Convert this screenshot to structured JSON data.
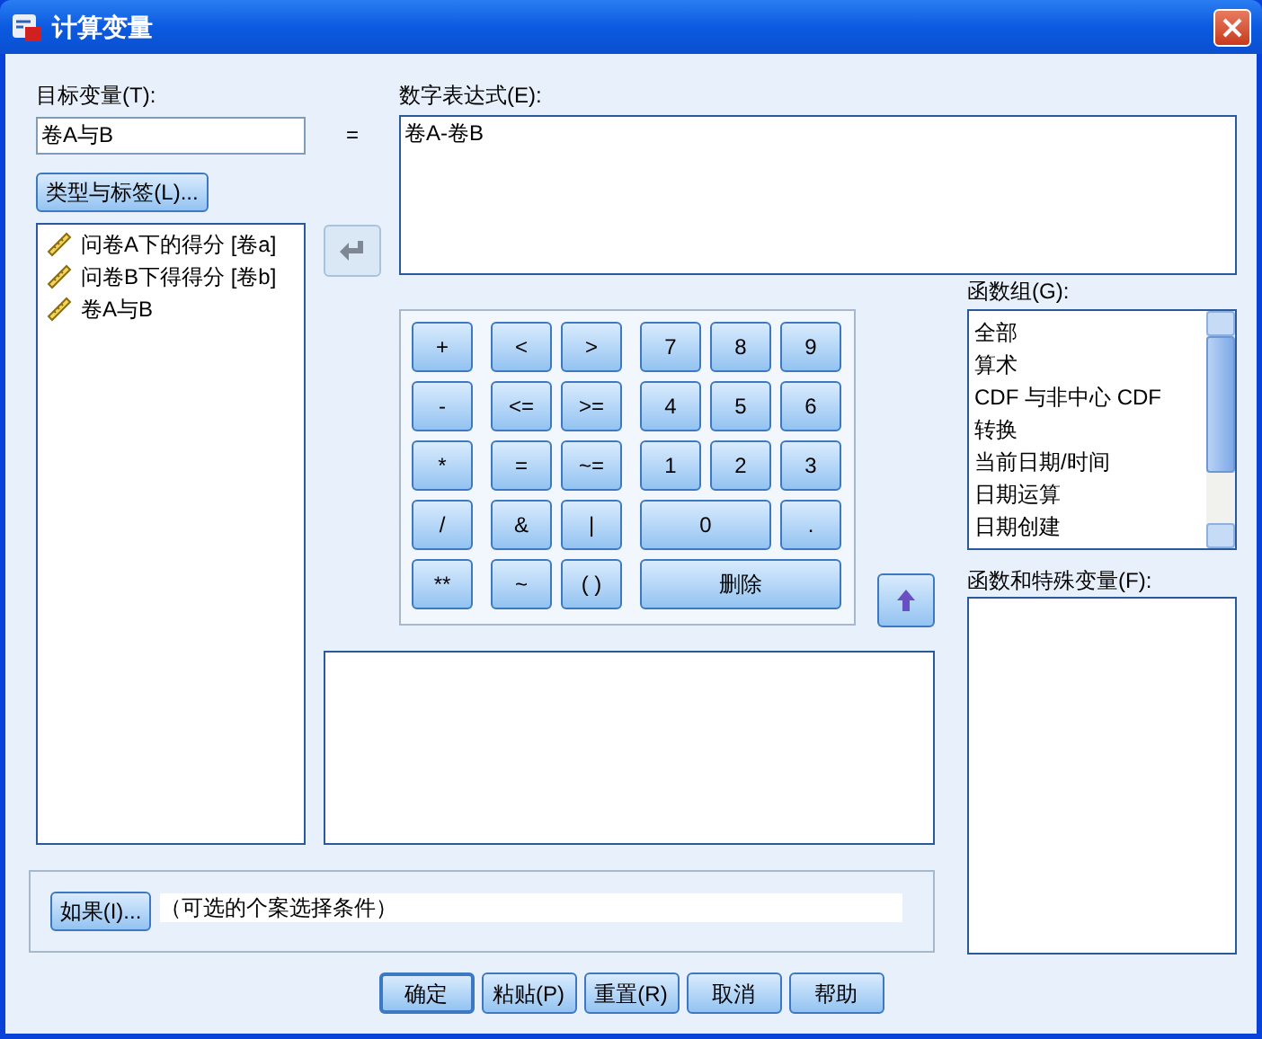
{
  "window": {
    "title": "计算变量"
  },
  "target_variable": {
    "label": "目标变量(T):",
    "value": "卷A与B"
  },
  "equals": "=",
  "type_label_button": "类型与标签(L)...",
  "variables": [
    {
      "name": "问卷A下的得分 [卷a]"
    },
    {
      "name": "问卷B下得得分 [卷b]"
    },
    {
      "name": "卷A与B"
    }
  ],
  "expression": {
    "label": "数字表达式(E):",
    "value": "卷A-卷B"
  },
  "keypad": [
    [
      {
        "label": "+",
        "kind": "key"
      },
      {
        "label": "<",
        "kind": "key"
      },
      {
        "label": ">",
        "kind": "key"
      },
      {
        "label": "7",
        "kind": "key"
      },
      {
        "label": "8",
        "kind": "key"
      },
      {
        "label": "9",
        "kind": "key"
      }
    ],
    [
      {
        "label": "-",
        "kind": "key"
      },
      {
        "label": "<=",
        "kind": "key"
      },
      {
        "label": ">=",
        "kind": "key"
      },
      {
        "label": "4",
        "kind": "key"
      },
      {
        "label": "5",
        "kind": "key"
      },
      {
        "label": "6",
        "kind": "key"
      }
    ],
    [
      {
        "label": "*",
        "kind": "key"
      },
      {
        "label": "=",
        "kind": "key"
      },
      {
        "label": "~=",
        "kind": "key"
      },
      {
        "label": "1",
        "kind": "key"
      },
      {
        "label": "2",
        "kind": "key"
      },
      {
        "label": "3",
        "kind": "key"
      }
    ],
    [
      {
        "label": "/",
        "kind": "key"
      },
      {
        "label": "&",
        "kind": "key"
      },
      {
        "label": "|",
        "kind": "key"
      },
      {
        "label": "0",
        "kind": "double"
      },
      {
        "label": ".",
        "kind": "key"
      }
    ],
    [
      {
        "label": "**",
        "kind": "key"
      },
      {
        "label": "~",
        "kind": "key"
      },
      {
        "label": "( )",
        "kind": "key"
      },
      {
        "label": "删除",
        "kind": "triple"
      }
    ]
  ],
  "function_groups": {
    "label": "函数组(G):",
    "items": [
      "全部",
      "算术",
      "CDF 与非中心 CDF",
      "转换",
      "当前日期/时间",
      "日期运算",
      "日期创建"
    ]
  },
  "functions": {
    "label": "函数和特殊变量(F):"
  },
  "condition": {
    "button": "如果(I)...",
    "text": "（可选的个案选择条件）"
  },
  "buttons": [
    {
      "label": "确定",
      "default": true
    },
    {
      "label": "粘贴(P)",
      "default": false
    },
    {
      "label": "重置(R)",
      "default": false
    },
    {
      "label": "取消",
      "default": false
    },
    {
      "label": "帮助",
      "default": false
    }
  ]
}
